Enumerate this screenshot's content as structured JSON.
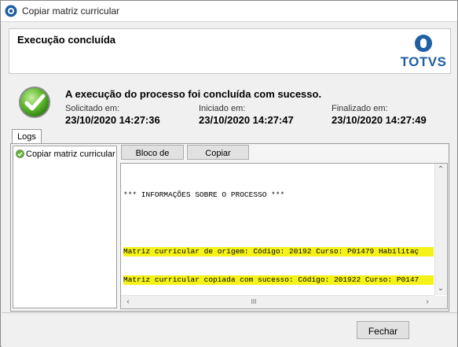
{
  "window": {
    "title": "Copiar matriz curricular",
    "icon": "totvs-app-icon"
  },
  "header": {
    "title": "Execução concluída",
    "logo_text": "TOTVS",
    "logo_color": "#1f5fa3"
  },
  "result": {
    "icon": "success-check-icon",
    "message": "A execução do processo foi concluída com sucesso.",
    "requested_label": "Solicitado em:",
    "requested_value": "23/10/2020 14:27:36",
    "started_label": "Iniciado em:",
    "started_value": "23/10/2020 14:27:47",
    "finished_label": "Finalizado em:",
    "finished_value": "23/10/2020 14:27:49"
  },
  "tabs": [
    {
      "label": "Logs",
      "selected": true
    }
  ],
  "logs": {
    "process_list": [
      {
        "label": "Copiar matriz curricular",
        "icon": "success-dot-icon"
      }
    ],
    "buttons": {
      "notepad": "Bloco de Notas",
      "copy": "Copiar"
    },
    "lines": [
      "*** INFORMAÇÕES SOBRE O PROCESSO ***",
      "",
      "Matriz curricular de origem: Código: 20192 Curso: P01479 Habilitaç",
      "Matriz curricular copiada com sucesso: Código: 201922 Curso: P0147"
    ],
    "highlight_color": "#f5f21a",
    "hscroll_thumb": "III"
  },
  "footer": {
    "close_label": "Fechar"
  }
}
